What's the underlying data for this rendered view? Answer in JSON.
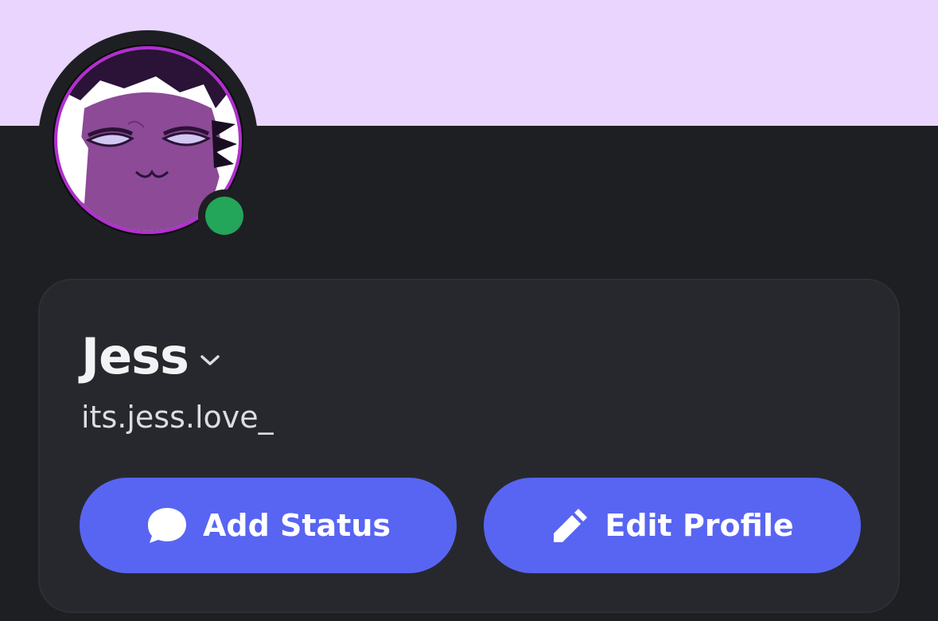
{
  "profile": {
    "display_name": "Jess",
    "username": "its.jess.love_",
    "status": "online"
  },
  "actions": {
    "add_status_label": "Add Status",
    "edit_profile_label": "Edit Profile"
  },
  "icons": {
    "chevron": "chevron-down-icon",
    "add_status": "speech-bubble-icon",
    "edit_profile": "pencil-icon"
  },
  "colors": {
    "banner": "#e9d5fd",
    "background": "#1e1f22",
    "card": "#27282e",
    "button": "#5865f2",
    "online": "#23a55a"
  }
}
